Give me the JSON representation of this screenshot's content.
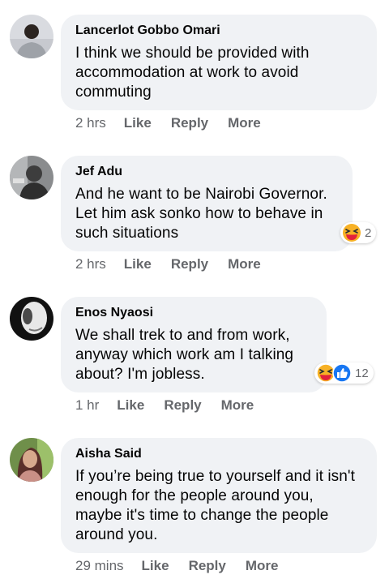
{
  "comments": [
    {
      "author": "Lancerlot Gobbo Omari",
      "text": "I think we should be provided with accommodation at work to avoid commuting",
      "time": "2 hrs",
      "like": "Like",
      "reply": "Reply",
      "more": "More"
    },
    {
      "author": "Jef Adu",
      "text": "And he want to be Nairobi Governor. Let him ask sonko how to behave in such situations",
      "time": "2 hrs",
      "like": "Like",
      "reply": "Reply",
      "more": "More",
      "reactions": {
        "icons": [
          "haha-icon"
        ],
        "count": "2"
      }
    },
    {
      "author": "Enos Nyaosi",
      "text": "We shall trek to and from work, anyway which work am I talking about? I'm jobless.",
      "time": "1 hr",
      "like": "Like",
      "reply": "Reply",
      "more": "More",
      "reactions": {
        "icons": [
          "haha-icon",
          "like-icon"
        ],
        "count": "12"
      }
    },
    {
      "author": "Aisha Said",
      "text": "If you’re being true to yourself and it isn't enough for the people around you, maybe it's time to change the people around you.",
      "time": "29 mins",
      "like": "Like",
      "reply": "Reply",
      "more": "More"
    }
  ],
  "colors": {
    "bubble": "#f0f2f5",
    "meta": "#65676b",
    "like_blue": "#1877f2",
    "haha_yellow": "#f7b125"
  }
}
